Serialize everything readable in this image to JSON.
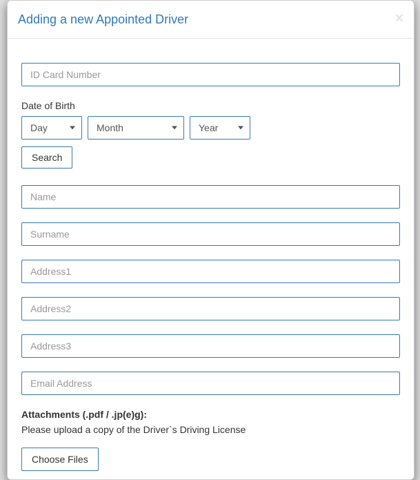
{
  "modal": {
    "title": "Adding a new Appointed Driver",
    "fields": {
      "id_card_placeholder": "ID Card Number",
      "dob_label": "Date of Birth",
      "day_placeholder": "Day",
      "month_placeholder": "Month",
      "year_placeholder": "Year",
      "search_label": "Search",
      "name_placeholder": "Name",
      "surname_placeholder": "Surname",
      "address1_placeholder": "Address1",
      "address2_placeholder": "Address2",
      "address3_placeholder": "Address3",
      "email_placeholder": "Email Address",
      "attachments_label": "Attachments (.pdf / .jp(e)g):",
      "attachments_hint": "Please upload a copy of the Driver`s Driving License",
      "choose_files_label": "Choose Files"
    }
  }
}
